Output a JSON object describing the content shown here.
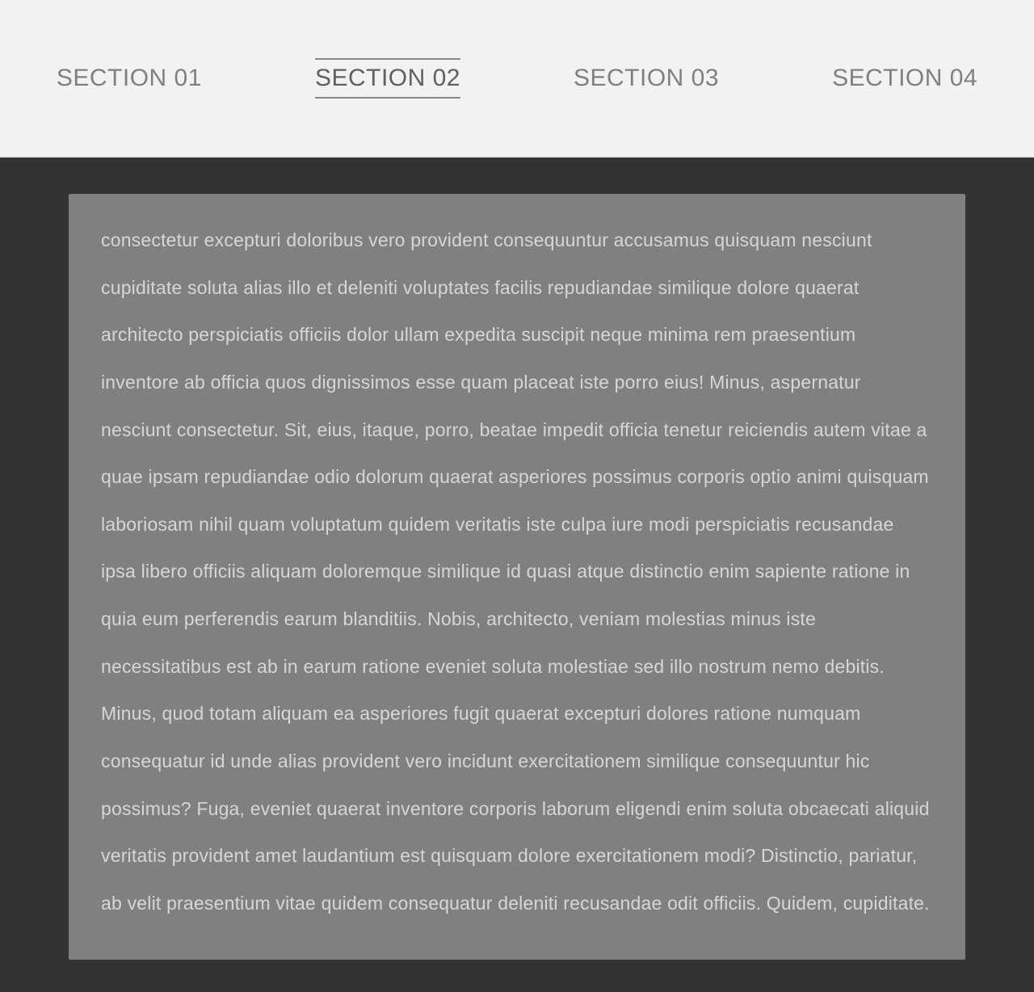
{
  "nav": {
    "items": [
      {
        "label": "SECTION 01",
        "active": false
      },
      {
        "label": "SECTION 02",
        "active": true
      },
      {
        "label": "SECTION 03",
        "active": false
      },
      {
        "label": "SECTION 04",
        "active": false
      }
    ]
  },
  "content": {
    "body": "consectetur excepturi doloribus vero provident consequuntur accusamus quisquam nesciunt cupiditate soluta alias illo et deleniti voluptates facilis repudiandae similique dolore quaerat architecto perspiciatis officiis dolor ullam expedita suscipit neque minima rem praesentium inventore ab officia quos dignissimos esse quam placeat iste porro eius! Minus, aspernatur nesciunt consectetur. Sit, eius, itaque, porro, beatae impedit officia tenetur reiciendis autem vitae a quae ipsam repudiandae odio dolorum quaerat asperiores possimus corporis optio animi quisquam laboriosam nihil quam voluptatum quidem veritatis iste culpa iure modi perspiciatis recusandae ipsa libero officiis aliquam doloremque similique id quasi atque distinctio enim sapiente ratione in quia eum perferendis earum blanditiis. Nobis, architecto, veniam molestias minus iste necessitatibus est ab in earum ratione eveniet soluta molestiae sed illo nostrum nemo debitis. Minus, quod totam aliquam ea asperiores fugit quaerat excepturi dolores ratione numquam consequatur id unde alias provident vero incidunt exercitationem similique consequuntur hic possimus? Fuga, eveniet quaerat inventore corporis laborum eligendi enim soluta obcaecati aliquid veritatis provident amet laudantium est quisquam dolore exercitationem modi? Distinctio, pariatur, ab velit praesentium vitae quidem consequatur deleniti recusandae odit officiis. Quidem, cupiditate."
  }
}
